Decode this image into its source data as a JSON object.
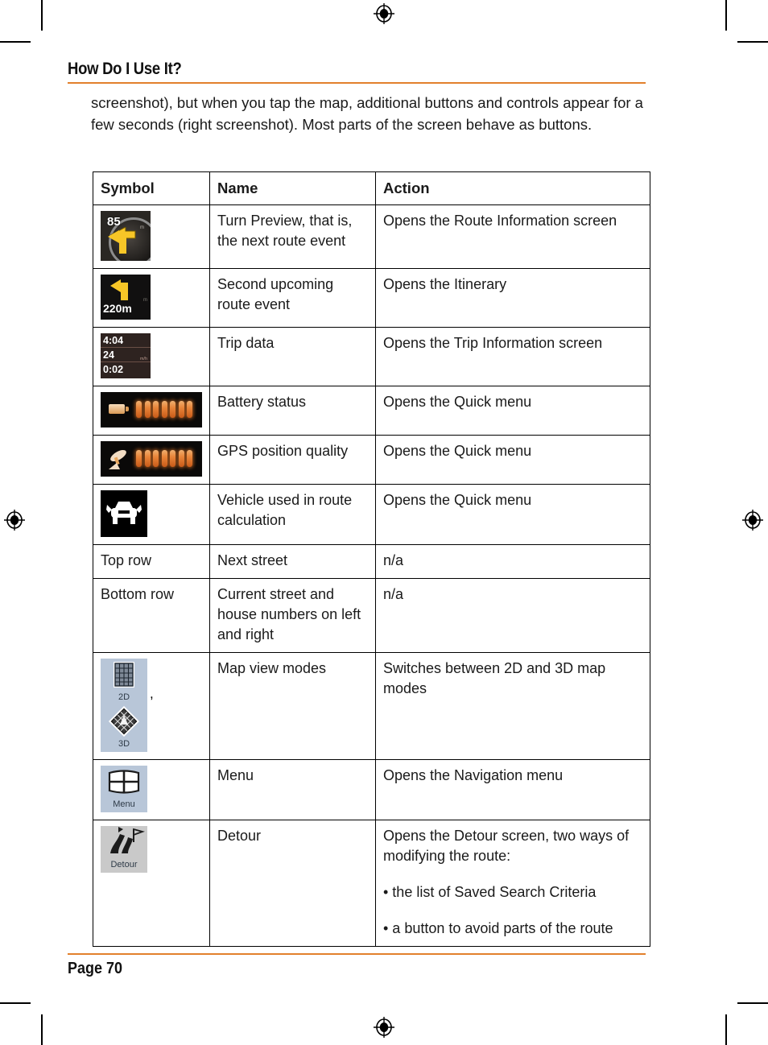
{
  "header": {
    "chapter_title": "How Do I Use It?"
  },
  "intro": {
    "paragraph": "screenshot), but when you tap the map, additional buttons and controls appear for a few seconds (right screenshot). Most parts of the screen behave as buttons."
  },
  "table": {
    "columns": [
      "Symbol",
      "Name",
      "Action"
    ],
    "rows": [
      {
        "symbol_kind": "turn-preview-icon",
        "symbol_text": {
          "distance": "85",
          "unit": "m"
        },
        "name": "Turn Preview, that is, the next route event",
        "action": [
          "Opens the Route Information screen"
        ]
      },
      {
        "symbol_kind": "second-route-event-icon",
        "symbol_text": {
          "distance": "220m",
          "unit": "m"
        },
        "name": "Second upcoming route event",
        "action": [
          "Opens the Itinerary"
        ]
      },
      {
        "symbol_kind": "trip-data-icon",
        "symbol_text": {
          "line1": "4:04",
          "line2": "24",
          "line2_unit": "m/h",
          "line3": "0:02"
        },
        "name": "Trip data",
        "action": [
          "Opens the Trip Information screen"
        ]
      },
      {
        "symbol_kind": "battery-status-icon",
        "symbol_text": {
          "bars": 7
        },
        "name": "Battery status",
        "action": [
          "Opens the Quick menu"
        ]
      },
      {
        "symbol_kind": "gps-position-quality-icon",
        "symbol_text": {
          "bars": 7
        },
        "name": "GPS position quality",
        "action": [
          "Opens the Quick menu"
        ]
      },
      {
        "symbol_kind": "vehicle-icon",
        "symbol_text": {},
        "name": "Vehicle used in route calculation",
        "action": [
          "Opens the Quick menu"
        ]
      },
      {
        "symbol_kind": "text",
        "symbol_text": {
          "label": "Top row"
        },
        "name": "Next street",
        "action": [
          "n/a"
        ]
      },
      {
        "symbol_kind": "text",
        "symbol_text": {
          "label": "Bottom row"
        },
        "name": "Current street and house numbers on left and right",
        "action": [
          "n/a"
        ]
      },
      {
        "symbol_kind": "map-view-modes-icon",
        "symbol_text": {
          "button_2d": "2D",
          "separator": ",",
          "button_3d": "3D"
        },
        "name": "Map view modes",
        "action": [
          "Switches between 2D and 3D map modes"
        ]
      },
      {
        "symbol_kind": "menu-icon",
        "symbol_text": {
          "caption": "Menu"
        },
        "name": "Menu",
        "action": [
          "Opens the Navigation menu"
        ]
      },
      {
        "symbol_kind": "detour-icon",
        "symbol_text": {
          "caption": "Detour"
        },
        "name": "Detour",
        "action": [
          "Opens the Detour screen, two ways of modifying the route:",
          "• the list of Saved Search Criteria",
          "• a button to avoid parts of the route"
        ]
      }
    ]
  },
  "footer": {
    "page_label": "Page 70"
  },
  "colors": {
    "rule": "#e2802c",
    "button_face": "#b8c6d8",
    "accent_arrow": "#f7c627",
    "bar_orange": "#e8853a"
  }
}
